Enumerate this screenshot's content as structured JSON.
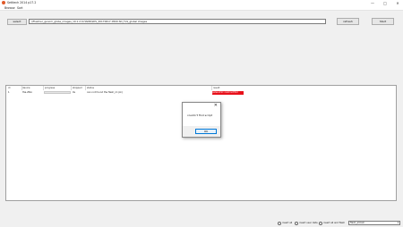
{
  "window": {
    "title": "Setitech 2014 p17.2",
    "minimize": "—",
    "maximize": "□",
    "close": "✕"
  },
  "menu": [
    "Browse",
    "Sort"
  ],
  "toolbar": {
    "select_label": "select",
    "path_value": "\\\\Flashier_genom_globe_images_10.1.2.0.HANS\\SDS_20170617-0500.SD_TLS_global images",
    "refresh_label": "refresh",
    "start_label": "Start"
  },
  "table": {
    "columns": [
      "id",
      "device",
      "progress",
      "stopped",
      "status",
      "result"
    ],
    "rows": [
      {
        "id": "1",
        "device": "Hai-Ztko",
        "stopped": "0s",
        "status": "can not found the flash_id (ok)",
        "result": "parse error: could not find"
      }
    ]
  },
  "dialog": {
    "close": "✕",
    "message": "couldn't find script",
    "ok_label": "OK"
  },
  "statusbar": {
    "radio1": "insert all",
    "radio2": "insert user data",
    "radio3": "insert all and flash",
    "select_value": "flash_all.bat"
  }
}
